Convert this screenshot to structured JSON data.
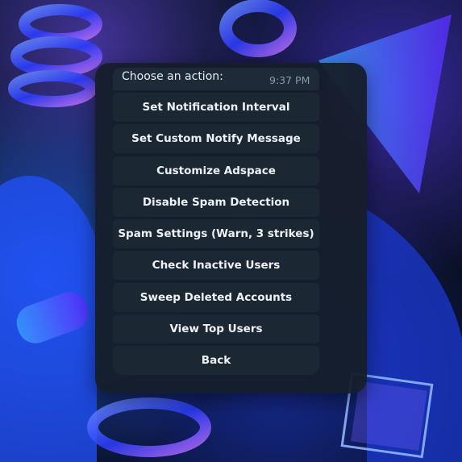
{
  "message": {
    "prompt": "Choose an action:",
    "time": "9:37 PM"
  },
  "keyboard": {
    "buttons": [
      "Set Notification Interval",
      "Set Custom Notify Message",
      "Customize Adspace",
      "Disable Spam Detection",
      "Spam Settings (Warn, 3 strikes)",
      "Check Inactive Users",
      "Sweep Deleted Accounts",
      "View Top Users",
      "Back"
    ]
  },
  "colors": {
    "panel": "#161e2c",
    "button": "#1c2734",
    "text": "#eef2f6",
    "timestamp": "#8d99a8"
  }
}
